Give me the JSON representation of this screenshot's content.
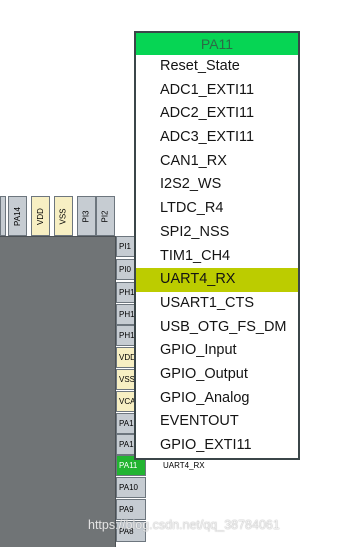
{
  "top_pins": [
    {
      "label": "PA14",
      "type": "io"
    },
    {
      "label": "VDD",
      "type": "power"
    },
    {
      "label": "VSS",
      "type": "power"
    },
    {
      "label": "PI3",
      "type": "io"
    },
    {
      "label": "PI2",
      "type": "io"
    }
  ],
  "side_pins": [
    {
      "label": "PI1",
      "type": "io"
    },
    {
      "label": "PI0",
      "type": "io"
    },
    {
      "label": "PH1",
      "type": "io"
    },
    {
      "label": "PH1",
      "type": "io"
    },
    {
      "label": "PH1",
      "type": "io"
    },
    {
      "label": "VDD",
      "type": "power"
    },
    {
      "label": "VSS",
      "type": "power"
    },
    {
      "label": "VCA",
      "type": "power"
    },
    {
      "label": "PA1",
      "type": "io"
    },
    {
      "label": "PA1",
      "type": "io"
    },
    {
      "label": "PA11",
      "type": "active"
    },
    {
      "label": "PA10",
      "type": "io"
    },
    {
      "label": "PA9",
      "type": "io"
    },
    {
      "label": "PA8",
      "type": "io"
    }
  ],
  "pin_signal_label": "UART4_RX",
  "popup": {
    "title": "PA11",
    "selected_index": 9,
    "items": [
      "Reset_State",
      "ADC1_EXTI11",
      "ADC2_EXTI11",
      "ADC3_EXTI11",
      "CAN1_RX",
      "I2S2_WS",
      "LTDC_R4",
      "SPI2_NSS",
      "TIM1_CH4",
      "UART4_RX",
      "USART1_CTS",
      "USB_OTG_FS_DM",
      "GPIO_Input",
      "GPIO_Output",
      "GPIO_Analog",
      "EVENTOUT",
      "GPIO_EXTI11"
    ]
  },
  "watermark": "https://blog.csdn.net/qq_38784061",
  "colors": {
    "header_green": "#06d554",
    "selected_yellow_green": "#bccc00",
    "active_pin_green": "#22b431",
    "chip_body": "#707476",
    "pin_gray": "#c6ccd2",
    "power_pin": "#f7efc3"
  }
}
